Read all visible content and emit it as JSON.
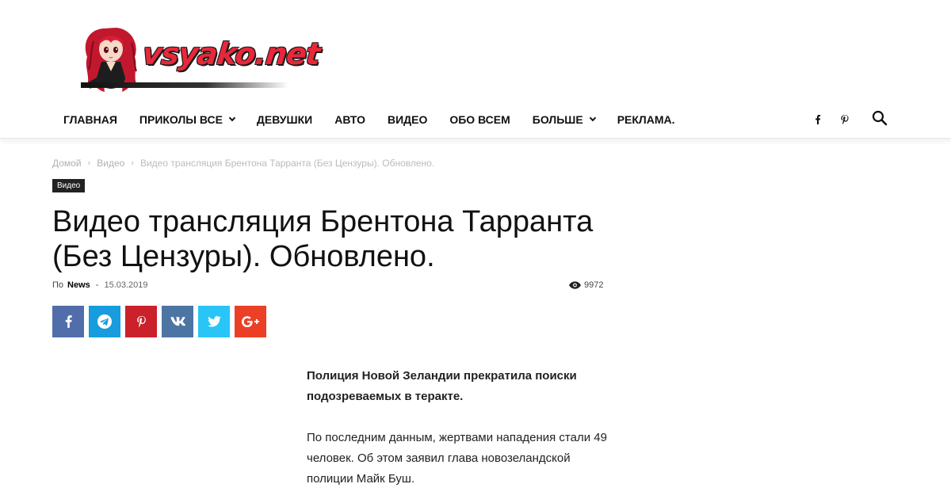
{
  "logo": {
    "text": "vsyako.net"
  },
  "nav": {
    "items": [
      {
        "label": "ГЛАВНАЯ",
        "dropdown": false
      },
      {
        "label": "ПРИКОЛЫ ВСЕ",
        "dropdown": true
      },
      {
        "label": "ДЕВУШКИ",
        "dropdown": false
      },
      {
        "label": "АВТО",
        "dropdown": false
      },
      {
        "label": "ВИДЕО",
        "dropdown": false
      },
      {
        "label": "ОБО ВСЕМ",
        "dropdown": false
      },
      {
        "label": "БОЛЬШЕ",
        "dropdown": true
      },
      {
        "label": "РЕКЛАМА.",
        "dropdown": false
      }
    ],
    "social_icons": [
      "facebook-icon",
      "pinterest-icon"
    ],
    "search_icon": "search-icon"
  },
  "breadcrumb": {
    "home": "Домой",
    "category": "Видео",
    "current": "Видео трансляция Брентона Тарранта (Без Цензуры). Обновлено."
  },
  "category_badge": "Видео",
  "article": {
    "title": "Видео трансляция Брентона Тарранта (Без Цензуры). Обновлено.",
    "by_label": "По",
    "author": "News",
    "date_separator": "-",
    "date": "15.03.2019",
    "views": "9972",
    "lead": "Полиция Новой Зеландии прекратила поиски подозреваемых в теракте.",
    "paragraph_1": "По последним данным, жертвами нападения стали 49 человек. Об этом заявил глава новозеландской полиции Майк Буш."
  },
  "share_buttons": [
    {
      "icon": "facebook-icon",
      "color": "#516eab"
    },
    {
      "icon": "telegram-icon",
      "color": "#179cde"
    },
    {
      "icon": "pinterest-icon",
      "color": "#ca212a"
    },
    {
      "icon": "vk-icon",
      "color": "#4c75a3"
    },
    {
      "icon": "twitter-icon",
      "color": "#29c5f6"
    },
    {
      "icon": "google-plus-icon",
      "color": "#eb4026"
    }
  ]
}
